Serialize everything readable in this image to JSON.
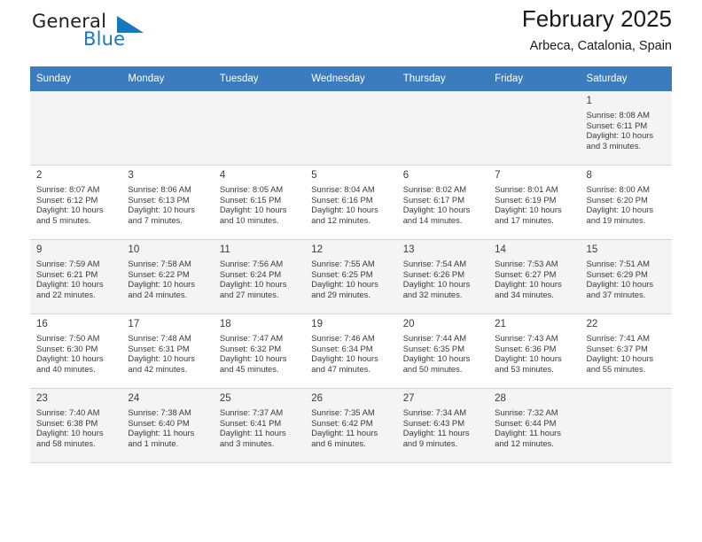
{
  "brand": {
    "name_part1": "General",
    "name_part2": "Blue",
    "logo_icon": "blue-triangle-logo"
  },
  "header": {
    "title": "February 2025",
    "location": "Arbeca, Catalonia, Spain"
  },
  "calendar": {
    "accent_color": "#3a7cbe",
    "weekday_headers": [
      "Sunday",
      "Monday",
      "Tuesday",
      "Wednesday",
      "Thursday",
      "Friday",
      "Saturday"
    ],
    "weeks": [
      [
        {
          "day": "",
          "sunrise": "",
          "sunset": "",
          "daylight_1": "",
          "daylight_2": "",
          "empty": true
        },
        {
          "day": "",
          "sunrise": "",
          "sunset": "",
          "daylight_1": "",
          "daylight_2": "",
          "empty": true
        },
        {
          "day": "",
          "sunrise": "",
          "sunset": "",
          "daylight_1": "",
          "daylight_2": "",
          "empty": true
        },
        {
          "day": "",
          "sunrise": "",
          "sunset": "",
          "daylight_1": "",
          "daylight_2": "",
          "empty": true
        },
        {
          "day": "",
          "sunrise": "",
          "sunset": "",
          "daylight_1": "",
          "daylight_2": "",
          "empty": true
        },
        {
          "day": "",
          "sunrise": "",
          "sunset": "",
          "daylight_1": "",
          "daylight_2": "",
          "empty": true
        },
        {
          "day": "1",
          "sunrise": "Sunrise: 8:08 AM",
          "sunset": "Sunset: 6:11 PM",
          "daylight_1": "Daylight: 10 hours",
          "daylight_2": "and 3 minutes.",
          "empty": false
        }
      ],
      [
        {
          "day": "2",
          "sunrise": "Sunrise: 8:07 AM",
          "sunset": "Sunset: 6:12 PM",
          "daylight_1": "Daylight: 10 hours",
          "daylight_2": "and 5 minutes.",
          "empty": false
        },
        {
          "day": "3",
          "sunrise": "Sunrise: 8:06 AM",
          "sunset": "Sunset: 6:13 PM",
          "daylight_1": "Daylight: 10 hours",
          "daylight_2": "and 7 minutes.",
          "empty": false
        },
        {
          "day": "4",
          "sunrise": "Sunrise: 8:05 AM",
          "sunset": "Sunset: 6:15 PM",
          "daylight_1": "Daylight: 10 hours",
          "daylight_2": "and 10 minutes.",
          "empty": false
        },
        {
          "day": "5",
          "sunrise": "Sunrise: 8:04 AM",
          "sunset": "Sunset: 6:16 PM",
          "daylight_1": "Daylight: 10 hours",
          "daylight_2": "and 12 minutes.",
          "empty": false
        },
        {
          "day": "6",
          "sunrise": "Sunrise: 8:02 AM",
          "sunset": "Sunset: 6:17 PM",
          "daylight_1": "Daylight: 10 hours",
          "daylight_2": "and 14 minutes.",
          "empty": false
        },
        {
          "day": "7",
          "sunrise": "Sunrise: 8:01 AM",
          "sunset": "Sunset: 6:19 PM",
          "daylight_1": "Daylight: 10 hours",
          "daylight_2": "and 17 minutes.",
          "empty": false
        },
        {
          "day": "8",
          "sunrise": "Sunrise: 8:00 AM",
          "sunset": "Sunset: 6:20 PM",
          "daylight_1": "Daylight: 10 hours",
          "daylight_2": "and 19 minutes.",
          "empty": false
        }
      ],
      [
        {
          "day": "9",
          "sunrise": "Sunrise: 7:59 AM",
          "sunset": "Sunset: 6:21 PM",
          "daylight_1": "Daylight: 10 hours",
          "daylight_2": "and 22 minutes.",
          "empty": false
        },
        {
          "day": "10",
          "sunrise": "Sunrise: 7:58 AM",
          "sunset": "Sunset: 6:22 PM",
          "daylight_1": "Daylight: 10 hours",
          "daylight_2": "and 24 minutes.",
          "empty": false
        },
        {
          "day": "11",
          "sunrise": "Sunrise: 7:56 AM",
          "sunset": "Sunset: 6:24 PM",
          "daylight_1": "Daylight: 10 hours",
          "daylight_2": "and 27 minutes.",
          "empty": false
        },
        {
          "day": "12",
          "sunrise": "Sunrise: 7:55 AM",
          "sunset": "Sunset: 6:25 PM",
          "daylight_1": "Daylight: 10 hours",
          "daylight_2": "and 29 minutes.",
          "empty": false
        },
        {
          "day": "13",
          "sunrise": "Sunrise: 7:54 AM",
          "sunset": "Sunset: 6:26 PM",
          "daylight_1": "Daylight: 10 hours",
          "daylight_2": "and 32 minutes.",
          "empty": false
        },
        {
          "day": "14",
          "sunrise": "Sunrise: 7:53 AM",
          "sunset": "Sunset: 6:27 PM",
          "daylight_1": "Daylight: 10 hours",
          "daylight_2": "and 34 minutes.",
          "empty": false
        },
        {
          "day": "15",
          "sunrise": "Sunrise: 7:51 AM",
          "sunset": "Sunset: 6:29 PM",
          "daylight_1": "Daylight: 10 hours",
          "daylight_2": "and 37 minutes.",
          "empty": false
        }
      ],
      [
        {
          "day": "16",
          "sunrise": "Sunrise: 7:50 AM",
          "sunset": "Sunset: 6:30 PM",
          "daylight_1": "Daylight: 10 hours",
          "daylight_2": "and 40 minutes.",
          "empty": false
        },
        {
          "day": "17",
          "sunrise": "Sunrise: 7:48 AM",
          "sunset": "Sunset: 6:31 PM",
          "daylight_1": "Daylight: 10 hours",
          "daylight_2": "and 42 minutes.",
          "empty": false
        },
        {
          "day": "18",
          "sunrise": "Sunrise: 7:47 AM",
          "sunset": "Sunset: 6:32 PM",
          "daylight_1": "Daylight: 10 hours",
          "daylight_2": "and 45 minutes.",
          "empty": false
        },
        {
          "day": "19",
          "sunrise": "Sunrise: 7:46 AM",
          "sunset": "Sunset: 6:34 PM",
          "daylight_1": "Daylight: 10 hours",
          "daylight_2": "and 47 minutes.",
          "empty": false
        },
        {
          "day": "20",
          "sunrise": "Sunrise: 7:44 AM",
          "sunset": "Sunset: 6:35 PM",
          "daylight_1": "Daylight: 10 hours",
          "daylight_2": "and 50 minutes.",
          "empty": false
        },
        {
          "day": "21",
          "sunrise": "Sunrise: 7:43 AM",
          "sunset": "Sunset: 6:36 PM",
          "daylight_1": "Daylight: 10 hours",
          "daylight_2": "and 53 minutes.",
          "empty": false
        },
        {
          "day": "22",
          "sunrise": "Sunrise: 7:41 AM",
          "sunset": "Sunset: 6:37 PM",
          "daylight_1": "Daylight: 10 hours",
          "daylight_2": "and 55 minutes.",
          "empty": false
        }
      ],
      [
        {
          "day": "23",
          "sunrise": "Sunrise: 7:40 AM",
          "sunset": "Sunset: 6:38 PM",
          "daylight_1": "Daylight: 10 hours",
          "daylight_2": "and 58 minutes.",
          "empty": false
        },
        {
          "day": "24",
          "sunrise": "Sunrise: 7:38 AM",
          "sunset": "Sunset: 6:40 PM",
          "daylight_1": "Daylight: 11 hours",
          "daylight_2": "and 1 minute.",
          "empty": false
        },
        {
          "day": "25",
          "sunrise": "Sunrise: 7:37 AM",
          "sunset": "Sunset: 6:41 PM",
          "daylight_1": "Daylight: 11 hours",
          "daylight_2": "and 3 minutes.",
          "empty": false
        },
        {
          "day": "26",
          "sunrise": "Sunrise: 7:35 AM",
          "sunset": "Sunset: 6:42 PM",
          "daylight_1": "Daylight: 11 hours",
          "daylight_2": "and 6 minutes.",
          "empty": false
        },
        {
          "day": "27",
          "sunrise": "Sunrise: 7:34 AM",
          "sunset": "Sunset: 6:43 PM",
          "daylight_1": "Daylight: 11 hours",
          "daylight_2": "and 9 minutes.",
          "empty": false
        },
        {
          "day": "28",
          "sunrise": "Sunrise: 7:32 AM",
          "sunset": "Sunset: 6:44 PM",
          "daylight_1": "Daylight: 11 hours",
          "daylight_2": "and 12 minutes.",
          "empty": false
        },
        {
          "day": "",
          "sunrise": "",
          "sunset": "",
          "daylight_1": "",
          "daylight_2": "",
          "empty": true
        }
      ]
    ]
  }
}
